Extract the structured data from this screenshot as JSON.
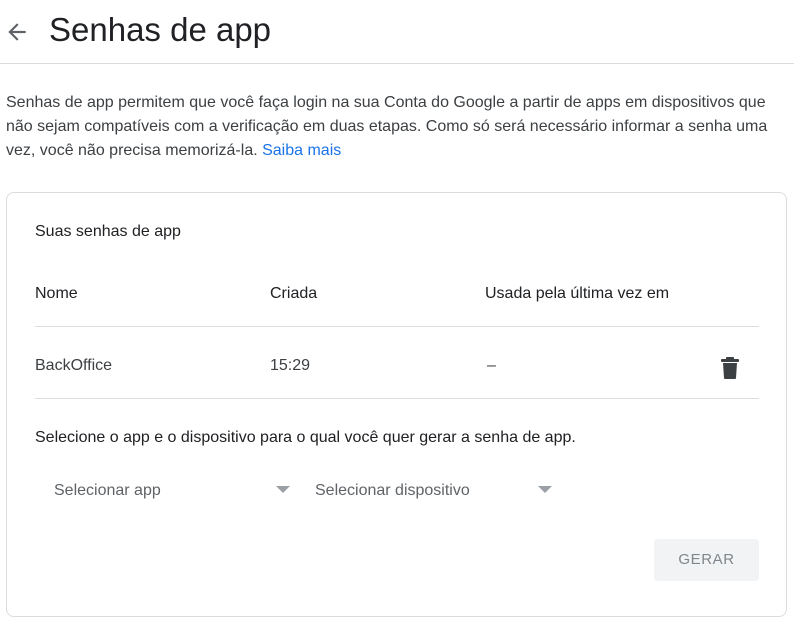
{
  "header": {
    "title": "Senhas de app",
    "back_icon": "arrow-left-icon"
  },
  "description": {
    "text": "Senhas de app permitem que você faça login na sua Conta do Google a partir de apps em dispositivos que não sejam compatíveis com a verificação em duas etapas. Como só será necessário informar a senha uma vez, você não precisa memorizá-la. ",
    "link_label": "Saiba mais"
  },
  "card": {
    "title": "Suas senhas de app",
    "columns": {
      "name": "Nome",
      "created": "Criada",
      "last_used": "Usada pela última vez em"
    },
    "rows": [
      {
        "name": "BackOffice",
        "created": "15:29",
        "last_used": "–",
        "action_icon": "trash-icon"
      }
    ],
    "instruction": "Selecione o app e o dispositivo para o qual você quer gerar a senha de app.",
    "select_app": "Selecionar app",
    "select_device": "Selecionar dispositivo",
    "generate_label": "GERAR"
  },
  "colors": {
    "link": "#1a73e8",
    "divider": "#dadce0",
    "button_bg": "#f1f3f4"
  }
}
